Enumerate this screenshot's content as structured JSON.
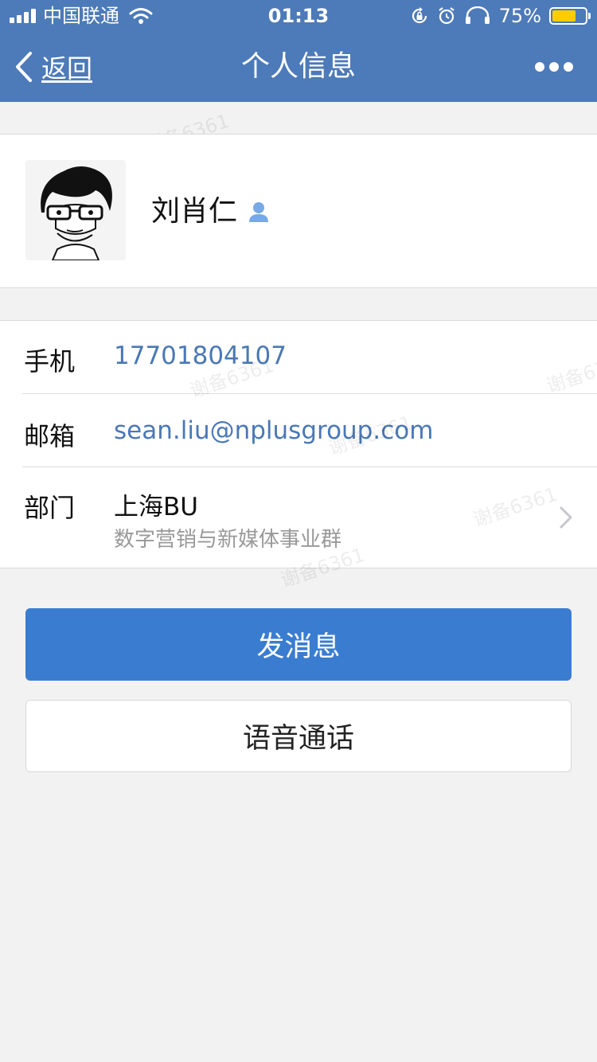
{
  "status_bar": {
    "carrier": "中国联通",
    "time": "01:13",
    "battery_percent": "75%",
    "battery_level": 0.75,
    "icons": [
      "signal-icon",
      "wifi-icon",
      "rotation-lock-icon",
      "alarm-icon",
      "headphones-icon",
      "battery-icon"
    ]
  },
  "nav": {
    "back_label": "返回",
    "title": "个人信息",
    "more_icon": "more-icon"
  },
  "profile": {
    "name": "刘肖仁",
    "person_icon": "person-icon",
    "avatar_icon": "avatar-icon"
  },
  "info": {
    "phone_label": "手机",
    "phone_value": "17701804107",
    "email_label": "邮箱",
    "email_value": "sean.liu@nplusgroup.com",
    "dept_label": "部门",
    "dept_value": "上海BU",
    "dept_sub": "数字营销与新媒体事业群"
  },
  "actions": {
    "message_label": "发消息",
    "call_label": "语音通话"
  },
  "watermark": "谢备6361",
  "colors": {
    "header": "#4d7ab8",
    "primary_button": "#3a7dd0",
    "link": "#4a78b5",
    "battery": "#ffcc00"
  }
}
